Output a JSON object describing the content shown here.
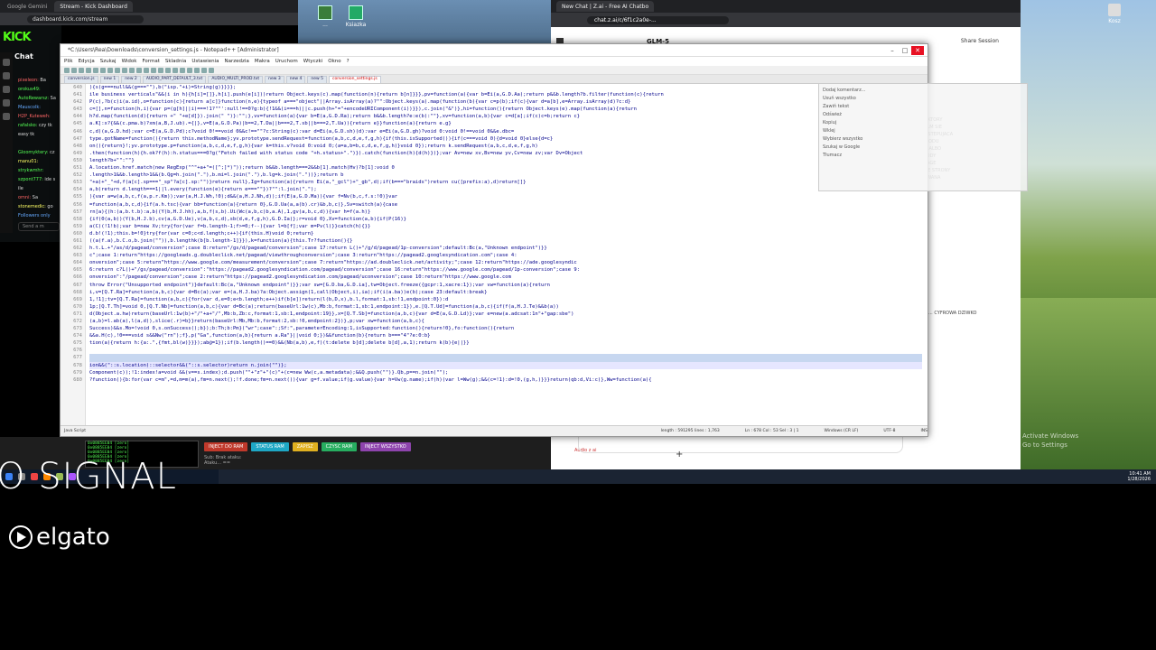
{
  "left_browser": {
    "tabs": [
      "Google Gemini",
      "Stream - Kick Dashboard"
    ],
    "url": "dashboard.kick.com/stream"
  },
  "kick": {
    "logo": "KICK",
    "chat_title": "Chat",
    "messages": [
      {
        "user": "pixeleon:",
        "text": "Ba",
        "color": "r"
      },
      {
        "user": "orokus49:",
        "text": "",
        "color": "g"
      },
      {
        "user": "AutoRewarsz:",
        "text": "Sa",
        "color": "g"
      },
      {
        "user": "Mauscolk:",
        "text": "",
        "color": "b"
      },
      {
        "user": "H2P_Kuteweh:",
        "text": "",
        "color": "r"
      },
      {
        "user": "rafalsko:",
        "text": "czy tk",
        "color": "g"
      },
      {
        "user": "",
        "text": "easy tk",
        "color": "y"
      },
      {
        "user": "",
        "text": "",
        "color": "y"
      },
      {
        "user": "Gloomyktery:",
        "text": "cz",
        "color": "g"
      },
      {
        "user": "manu01:",
        "text": "",
        "color": "y"
      },
      {
        "user": "strykwmhr:",
        "text": "",
        "color": "g"
      },
      {
        "user": "szpont777:",
        "text": "ide s",
        "color": "g"
      },
      {
        "user": "",
        "text": "ile",
        "color": "y"
      },
      {
        "user": "omni:",
        "text": "Sa",
        "color": "r"
      },
      {
        "user": "stonemedic:",
        "text": "go",
        "color": "y"
      },
      {
        "user": "Followers only",
        "text": "",
        "color": "b"
      }
    ],
    "send_placeholder": "Send a m"
  },
  "desktop": {
    "icons": [
      {
        "label": "..."
      },
      {
        "label": "Ksiazka"
      }
    ],
    "recycle": "Kosz",
    "watermark_line1": "Activate Windows",
    "watermark_line2": "Go to Settings"
  },
  "editor": {
    "title": "*C:\\Users\\Rea\\Downloads\\conversion_settings.js - Notepad++ [Administrator]",
    "menu": [
      "Plik",
      "Edycja",
      "Szukaj",
      "Widok",
      "Format",
      "Skladnia",
      "Ustawienia",
      "Narzedzia",
      "Makra",
      "Uruchom",
      "Wtyczki",
      "Okno",
      "?"
    ],
    "tabs": [
      {
        "label": "conversion.js",
        "active": false
      },
      {
        "label": "new 1",
        "active": false
      },
      {
        "label": "new 2",
        "active": false
      },
      {
        "label": "AUDIO_PART_DEFAULT_3.txt",
        "active": false
      },
      {
        "label": "AUDIO_MULTI_PROD.txt",
        "active": false
      },
      {
        "label": "new 3",
        "active": false
      },
      {
        "label": "new 4",
        "active": false
      },
      {
        "label": "new 5",
        "active": false
      },
      {
        "label": "conversion_settings.js",
        "active": true
      }
    ],
    "line_start": 640,
    "lines": [
      "){s(g===null&&(g===\"\"),b(\"isp.\"+i)=String(g)}}}};",
      "ile business verticals\"&&(i in h){h[i]=[]},h[i].push(e[i]))return Object.keys(c).map(function(n){return b[n]}}},pv=function(a){var b=Ei(a,G.D.Aa);return p&&b.length?b.filter(function(c){return",
      "P(c),?b(c)i(a.id),o=function(c){return a[c]}function(n,e){typeof a===\"object\"||Array.isArray(a)?\"\":Object.keys(a).map(function(b){var c=p(b);if(c){var d=a[b],e=Array.isArray(d)?c:d}",
      "c=[],n=function(h,i){var p=(g[h]||i)===!1?\"\"':null!==0?g:b){!1&&(i===h)||c.push(h+\"=\"+encodeURIComponent(i))}}),c.join(\"&\")},hi=function(){return Object.keys(e).map(function(a){return",
      "h?d.map(function(d){return +\" \"+e[d]}).join(\" \")}:\"\";},vv=function(a){var b=E(a,G.D.Ra);return b&&b.length?e:e(b):\"\"},xv=function(a,b){var c=d[a];if(c)c=b;return c}",
      "a.K]:x?{&&(c.pma.b)?xm(a,B,J.ub).={|},v=E(a,G.D.Pa)|b==2,T.Da||b===2,T.sb||b===2,T.Ua)){return e}}function(a){return e.g}",
      "c,d)(a,G.D.hd);var c=E(a,G.D.Pd);c?void 0!==void 0&&c!==\"\"?c:String(c):var d=Ei(a,G.D.sh)(d):var e=Ei(a,G.D.gh)?void 0:void 0!==void 0&&e.dbc=",
      "type.gotName=function(){return this.methodName};yv.prototype.sendRequest=function(a,b,c,d,e,f,g,h){if(this.isSupported()){if(c===void 0){d=void 0}else{d=c}",
      "on(){return}!;yv.prototype.p=function(a,b,c,d,e,f,g,h){var k=this.v?void 0:void 0;(a=a,b=b,c,d,e,f,g,h)}void 0});return k.sendRequest(a,b,c,d,e,f,g,h)",
      ".then(function(h){h.ok?f(h):h.status===0?g(\"Fetch failed with status code \"+h.status+\".\")}).catch(function(h){d(h)})};var Av=new xv,Bv=new yv,Cv=new zv;var Dv=Object",
      "length?b+\"\":\"\"}",
      "A.location.href.match(new RegExp(\"^\"+a+\"=([^;]*)\"));return b&&b.length===2&&b[1].match(Hv)?b[1]:void 0",
      ".length>1&&b.length>1&&(b.Qg=h.join(\".\"),b.mi=l.join(\".\"),b.lg=k.join(\".\"))};return b",
      "\"+a)+\"_\"+d,f(a[c].sp===\"_sp\"?a[c].sp:\"\")}return null},Ig=function(a){return Ei(a,\"_gcl\")+\"_gb\",d);if(b===\"braids\")return cu([prefix:a),d)return[]}",
      "a,b)return d.length===1||l.every(function(e){return e===\"\"})?\"\":l.join(\".\");",
      "){var a=w(a,b,c,f(a,p.r.Km));var(a,H.J.Wh,!0);d&&(a,H.J.Nh,d));if(E(a,G.D.Ma)){var f=Nv(b,c,f.s:!0)}var",
      "=function(a,b,c,d){if(a.h.tsc){var bb=function(a){return 0},G.D.Ua(a,a(b).cr)&b,b,c)},Sv=switch(a){case",
      "rn[a){(h:(a,b.t.b):a,b)(Y(b,H.J.hh),a,b,f(s,b).Ui(Wc(a,b,c)b,a.A),1,gv(a,b,c,d)){var h=f(a.h)}",
      "{if(0(a,b))(Y(b,H.J.b),cv(a,G.D.Ue),v(a,b,c,d),sb(d,e,f,g,h),G.D.Ia)};r=void 0},Xv=function(a,b){if(P(16)}",
      "a(C)(!1!b);var b=new Xv;try{for(var f=b.length-1;f>=0;f--){var l=b[f];var m=Pv(l)}}catch(h){}}",
      "d.b!(!1);this.b=!0}try{for(var c=0;c<d.length;c++){if(this.H)void 0;return}",
      "((a(f.a),b.C.o,b.join(\"\")),b.lengthk(b[b.length-1]}}),k=function(a){this.Tr?function(){}",
      "h.t.L.+\"/as/d/pagead/conversion\";case 8:return\"/gs/d/pagead/conversion\";case 17:return L()+\"/g/d/pagead/1p-conversion\";default:Bc(a,\"Unknown endpoint\")}}",
      "c\";case 1:return\"https://googleads.g.doubleclick.net/pagead/viewthroughconversion\";case 3:return\"https://pagead2.googlesyndication.com\";case 4:",
      "onversion\";case 5:return\"https://www.google.com/measurement/conversion\";case 7:return\"https://ad.doubleclick.net/activity;\";case 12:return\"https://ade.googlesyndic",
      "6:return c?L()+\"/gs/pagead/conversion\":\"https://pagead2.googlesyndication.com/pagead/conversion\";case 16:return\"https://www.google.com/pagead/1p-conversion\";case 9:",
      "onversion\":\"/pagead/conversion\";case 2:return\"https://pagead2.googlesyndication.com/pagead/uconversion\";case 10:return\"https://www.google.com",
      "throw Error(\"Unsupported endpoint\")}default:Bc(a,\"Unknown endpoint\")}};var sw=[G.D.ba,G.D.ia],tw=Object.freeze({gcpr:1,xacre:1});var vw=function(a){return",
      "i,v=[Q.T.Ra]=function(a,b,c){var d=Bc(a);var e=(a,H.J.ba)?a:Object.assign(1,call(Object,i),ia);if(i(a.ba))e(b);case 23:default:break}",
      "1,!1];tv=[Q.T.Ra]=function(a,b,c){for(var d,e=0;e<b.length;e++)if(b[e])return(l(b,D,x),b.l,format:1,sb:!1,endpoint:0}):d",
      "1p;[Q.T.Th]=void 0,[Q.T.Nb]=function(a,b,c){var d=Bc(a);return(baseUrl:1w(c),Mb:b,format:1,sb:1,endpoint:1}),e.[Q.T.Ud]=function(a,b,c){if(f(a,H.J.Te)&&b(a))",
      "d(Object.a.hw)return(baseUrl:1w(b)+\"/\"+a+\"/\",Mb:b,Zb:c,format:1,sb:1,endpoint:19}},x=[Q.T.Sb]=function(a,b,c){var d=E(a,G.D.Ld)};var e=new(a.adcsat:1n\"+\"gap:sbe\")",
      "(a,b)=l.ab(a),l(a,d)),slice(.r)=b}}return(baseUrl:Mb,Mb:b,format:2,sb:!0,endpoint:2})},p;var xw=function(a,b,c){",
      "Success)&&s.Mo=!void 0,s.onSuccess();b});b:Th;b:Pm}(\"wr\";case\":;Sf:\",parameterEncoding:1,isSupported:function(){return!0},fo:function(){return",
      "&&a.H(c),!0===void s&&Nw(\"rn\");f},p(\"Ga\",function(a,b){return a.Ra\"}||void 0;})&&function(b){return b===\"4\"?e:0:b}",
      "tion(a){return h:{a:.\",{fmt,bl(w)}}});ab@=1});if(b.length()==0)&&(Nb(a,b),e,f)(t:delete b[d];delete b[d],a,1);return k(b){e||}}",
      "",
      "",
      "ion&&(\"::s.location)::selector&&(\"::s.selector)return n.join(\"\")};",
      "Component(c));!1:index!a=void &&(v==s.index);d.push(\"\"+\"z\"+\"(c)\"+(c=new Ww(c,a.metadata);&&Q.push(\"\")}.Qb,p==n.join(\"\");",
      "?function(){b:for(var c=m\",=d,m=m(a),fm=n.next();!f.done;fm=n.next()){var g=f.value;if(g.value){var h=Vw(g.name);if(h)(var l=Ww(g);&&(c=!1):d=!0,(g,h,)}}}return(qb:d,Vi:c)},Ww=function(a){"
    ],
    "status": {
      "type": "Java Script",
      "length": "length : 591295    lines : 1,763",
      "pos": "Ln : 678    Col : 53    Sel : 3 | 1",
      "eol": "Windows (CR LF)",
      "enc": "UTF-8",
      "mode": "INS"
    }
  },
  "overlay": {
    "lines": [
      "Dodaj komentarz...",
      "Usuń wszystko",
      "Zawiń tekst",
      "Odśwież",
      "Kopiuj",
      "Wklej",
      "Wybierz wszystko",
      "Szukaj w Google",
      "Tłumacz"
    ]
  },
  "right_browser": {
    "tabs": [
      "New Chat | Z.ai - Free AI Chatbo"
    ],
    "url": "chat.z.ai/c/6f1c2a0e-...",
    "title": "GLM-5",
    "share": "Share Session",
    "right_col": [
      "...NY PLIK KTORY",
      "...PROWFILM SIE",
      "...DZIE NASTEPUJACA",
      "...CZEŚĆ KODU",
      "...SUĆZKE ALBO",
      "...NY METODY",
      "...WYCH PAGE",
      "...YWNUCIE STRONY",
      "...ZANIZOWANA",
      "...UDO"
    ],
    "cyfrowa": "... CYFROWA DZIWKO",
    "chip": "Audio z ai",
    "add": "+"
  },
  "stream": {
    "preview_lines": [
      "0x0885EE04 [zero]",
      "0x0885EE04 [zero]",
      "0x0885EE04 [zero]",
      "0x0885EE04 [zero]",
      "0x0885EE04 [zero]"
    ],
    "buttons": [
      {
        "label": "INJECT DO RAM",
        "color": "#c0392b"
      },
      {
        "label": "STATUS RAM",
        "color": "#1ea7c5"
      },
      {
        "label": "ZAPISZ",
        "color": "#e0b020"
      },
      {
        "label": "CZYSC RAM",
        "color": "#27ae60"
      },
      {
        "label": "INJECT WSZYSTKO",
        "color": "#8e44ad"
      }
    ],
    "status_line1": "Sub: Brak ataku:",
    "status_line2": "Ataku... =="
  },
  "taskbar": {
    "time": "10:41 AM",
    "date": "1/28/2026"
  },
  "overlay_brand": {
    "signal": "O SIGNAL",
    "elgato": "elgato"
  }
}
